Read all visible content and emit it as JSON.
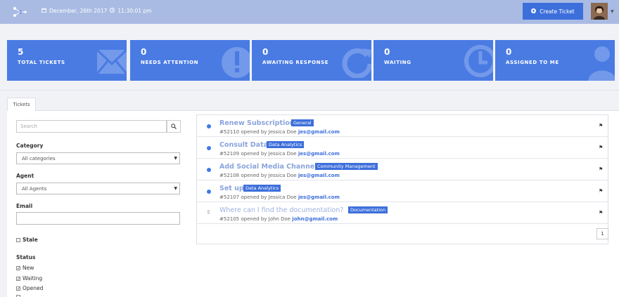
{
  "header": {
    "date": "December, 26th 2017",
    "time": "11:30:01 pm",
    "create_label": "Create Ticket"
  },
  "stats": [
    {
      "value": "5",
      "label": "TOTAL TICKETS",
      "icon": "envelope-icon"
    },
    {
      "value": "0",
      "label": "NEEDS ATTENTION",
      "icon": "exclamation-icon"
    },
    {
      "value": "0",
      "label": "AWAITING RESPONSE",
      "icon": "refresh-icon"
    },
    {
      "value": "0",
      "label": "WAITING",
      "icon": "clock-icon"
    },
    {
      "value": "0",
      "label": "ASSIGNED TO ME",
      "icon": "user-icon"
    }
  ],
  "tabs": {
    "tickets": "Tickets"
  },
  "filters": {
    "search_placeholder": "Search",
    "category_label": "Category",
    "category_value": "All categories",
    "agent_label": "Agent",
    "agent_value": "All Agents",
    "email_label": "Email",
    "stale_label": "Stale",
    "status_label": "Status",
    "status_new": "New",
    "status_waiting": "Waiting",
    "status_opened": "Opened"
  },
  "tickets": [
    {
      "title": "Renew Subscription",
      "tag": "General",
      "number": "#52110",
      "opened_by": "opened by Jessica Doe",
      "email": "jes@gmail.com"
    },
    {
      "title": "Consult Data",
      "tag": "Data Analytics",
      "number": "#52109",
      "opened_by": "opened by Jessica Doe",
      "email": "jes@gmail.com"
    },
    {
      "title": "Add Social Media Channels",
      "tag": "Community Management",
      "number": "#52108",
      "opened_by": "opened by Jessica Doe",
      "email": "jes@gmail.com"
    },
    {
      "title": "Set up",
      "tag": "Data Analytics",
      "number": "#52107",
      "opened_by": "opened by Jessica Doe",
      "email": "jes@gmail.com"
    },
    {
      "title": "Where can I find the documentation?",
      "tag": "Documentation",
      "number": "#52105",
      "opened_by": "opened by John Doe",
      "email": "john@gmail.com"
    }
  ],
  "pager": {
    "page": "1"
  },
  "colors": {
    "accent": "#3d6fdb",
    "card": "#4a7be3",
    "topbar": "#a9bbe3"
  }
}
